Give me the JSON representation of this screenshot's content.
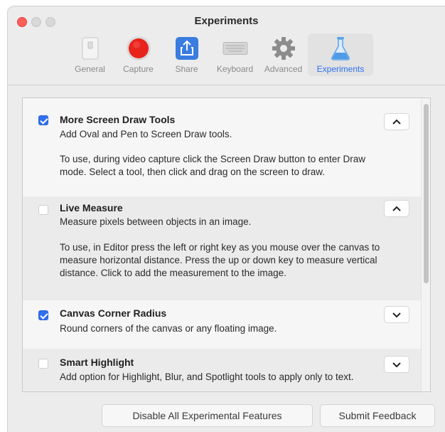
{
  "window": {
    "title": "Experiments"
  },
  "toolbar": {
    "items": [
      {
        "label": "General",
        "icon": "general-icon"
      },
      {
        "label": "Capture",
        "icon": "record-icon"
      },
      {
        "label": "Share",
        "icon": "share-icon"
      },
      {
        "label": "Keyboard",
        "icon": "keyboard-icon"
      },
      {
        "label": "Advanced",
        "icon": "gear-icon"
      },
      {
        "label": "Experiments",
        "icon": "flask-icon"
      }
    ],
    "selected": "Experiments"
  },
  "features": [
    {
      "title": "More Screen Draw Tools",
      "subtitle": "Add Oval and Pen to Screen Draw tools.",
      "description": "To use, during video capture click the Screen Draw button to enter Draw mode. Select a tool, then click and drag on the screen to draw.",
      "enabled": true,
      "expanded": true
    },
    {
      "title": "Live Measure",
      "subtitle": "Measure pixels between objects in an image.",
      "description": "To use, in Editor press the left or right key as you mouse over the canvas to measure horizontal distance. Press the up or down key to measure vertical distance. Click to add the measurement to the image.",
      "enabled": false,
      "expanded": true
    },
    {
      "title": "Canvas Corner Radius",
      "subtitle": "Round corners of the canvas or any floating image.",
      "enabled": true,
      "expanded": false
    },
    {
      "title": "Smart Highlight",
      "subtitle": "Add option for Highlight, Blur, and Spotlight tools to apply only to text.",
      "enabled": false,
      "expanded": false
    }
  ],
  "buttons": {
    "disable_all": "Disable All Experimental Features",
    "submit_feedback": "Submit Feedback"
  },
  "colors": {
    "accent": "#2f6ff0",
    "close": "#fc5f57",
    "record": "#e8231c"
  }
}
